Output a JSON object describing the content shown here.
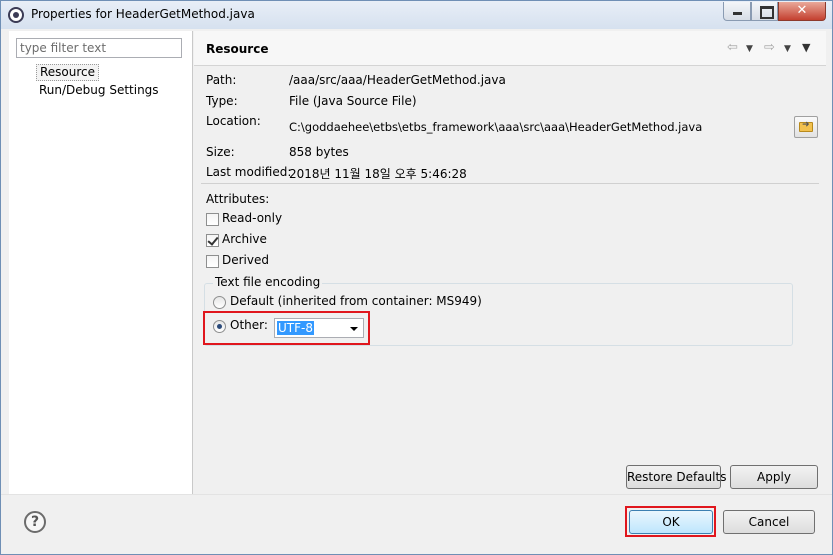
{
  "window": {
    "title": "Properties for HeaderGetMethod.java",
    "close_glyph": "✕"
  },
  "filter": {
    "placeholder": "type filter text"
  },
  "tree": {
    "items": [
      {
        "label": "Resource",
        "selected": true
      },
      {
        "label": "Run/Debug Settings",
        "selected": false
      }
    ]
  },
  "page": {
    "title": "Resource",
    "nav": {
      "back_icon": "⇦",
      "forward_icon": "⇨",
      "dropdown_icon": "▼"
    }
  },
  "properties": {
    "path_label": "Path:",
    "path_value": "/aaa/src/aaa/HeaderGetMethod.java",
    "type_label": "Type:",
    "type_value": "File  (Java Source File)",
    "location_label": "Location:",
    "location_value": "C:\\goddaehee\\etbs\\etbs_framework\\aaa\\src\\aaa\\HeaderGetMethod.java",
    "size_label": "Size:",
    "size_value": "858  bytes",
    "modified_label": "Last modified:",
    "modified_value": "2018년 11월 18일 오후 5:46:28"
  },
  "attributes": {
    "heading": "Attributes:",
    "read_only": {
      "label": "Read-only",
      "checked": false
    },
    "archive": {
      "label": "Archive",
      "checked": true
    },
    "derived": {
      "label": "Derived",
      "checked": false
    }
  },
  "encoding": {
    "legend": "Text file encoding",
    "default_label": "Default (inherited from container: MS949)",
    "other_label": "Other:",
    "selected": "other",
    "other_value": "UTF-8"
  },
  "buttons": {
    "restore_defaults": "Restore Defaults",
    "apply": "Apply",
    "ok": "OK",
    "cancel": "Cancel",
    "help_glyph": "?"
  },
  "colors": {
    "highlight": "#e0161d",
    "selection": "#3399ff"
  }
}
